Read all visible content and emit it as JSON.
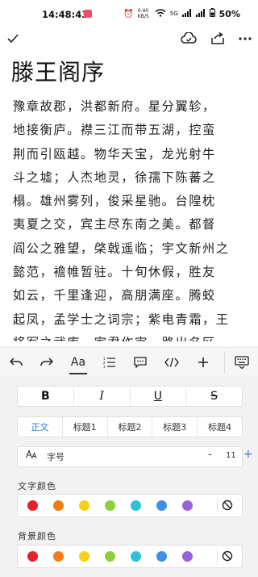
{
  "status": {
    "time": "14:48:43",
    "net_speed": "0.40 KB/S",
    "network": "5G",
    "battery": "50%"
  },
  "doc": {
    "title": "滕王阁序",
    "lines": [
      "豫章故郡，洪都新府。星分翼轸，",
      "地接衡庐。襟三江而带五湖，控蛮",
      "荆而引瓯越。物华天宝，龙光射牛",
      "斗之墟；人杰地灵，徐孺下陈蕃之",
      "榻。雄州雾列，俊采星驰。台隍枕",
      "夷夏之交，宾主尽东南之美。都督",
      "阎公之雅望，棨戟遥临；宇文新州之",
      "懿范，襜帷暂驻。十旬休假，胜友",
      "如云，千里逢迎，高朋满座。腾蛟",
      "起凤，孟学士之词宗；紫电青霜，王",
      "将军之武库。家君作宰，路出名区"
    ]
  },
  "format": {
    "bold": "B",
    "italic": "I",
    "underline": "U",
    "strike": "S",
    "paragraph_styles": [
      "正文",
      "标题1",
      "标题2",
      "标题3",
      "标题4"
    ],
    "font_size_label": "字号",
    "font_size_value": "11",
    "minus": "-",
    "plus": "+",
    "text_color_label": "文字颜色",
    "bg_color_label": "背景颜色",
    "colors": [
      "#e8202a",
      "#f57c14",
      "#f7d117",
      "#8bd13a",
      "#2cc2d8",
      "#3f8fe6",
      "#9a62d9"
    ]
  },
  "toolbar": {
    "aa_label": "Aa"
  }
}
